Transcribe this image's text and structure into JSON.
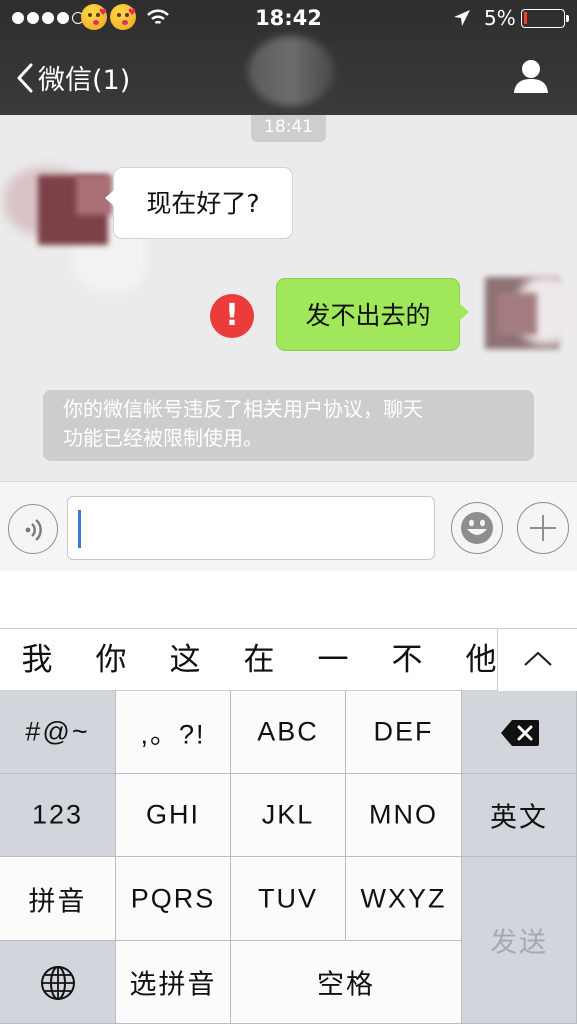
{
  "status_bar": {
    "time": "18:42",
    "battery_percent": "5%",
    "signal_bars_filled": 4,
    "signal_bars_total": 5
  },
  "nav": {
    "back_label": "微信(1)"
  },
  "chat": {
    "timestamp": "18:41",
    "messages": [
      {
        "direction": "incoming",
        "text": "现在好了?"
      },
      {
        "direction": "outgoing",
        "text": "发不出去的",
        "failed": true
      }
    ],
    "system_notice": "你的微信帐号违反了相关用户协议，聊天\n功能已经被限制使用。"
  },
  "input": {
    "value": ""
  },
  "keyboard": {
    "candidates": [
      "我",
      "你",
      "这",
      "在",
      "一",
      "不",
      "他"
    ],
    "keys": {
      "symbols": "#@~",
      "punct": ",。?!",
      "abc": "ABC",
      "def": "DEF",
      "num": "123",
      "ghi": "GHI",
      "jkl": "JKL",
      "mno": "MNO",
      "english": "英文",
      "pinyin": "拼音",
      "pqrs": "PQRS",
      "tuv": "TUV",
      "wxyz": "WXYZ",
      "send": "发送",
      "select_pinyin": "选拼音",
      "space": "空格"
    }
  },
  "colors": {
    "outgoing_bubble": "#a0e75a",
    "error_badge": "#ea3c3a",
    "caret": "#3a7bd5",
    "battery_low": "#ff3b30"
  }
}
